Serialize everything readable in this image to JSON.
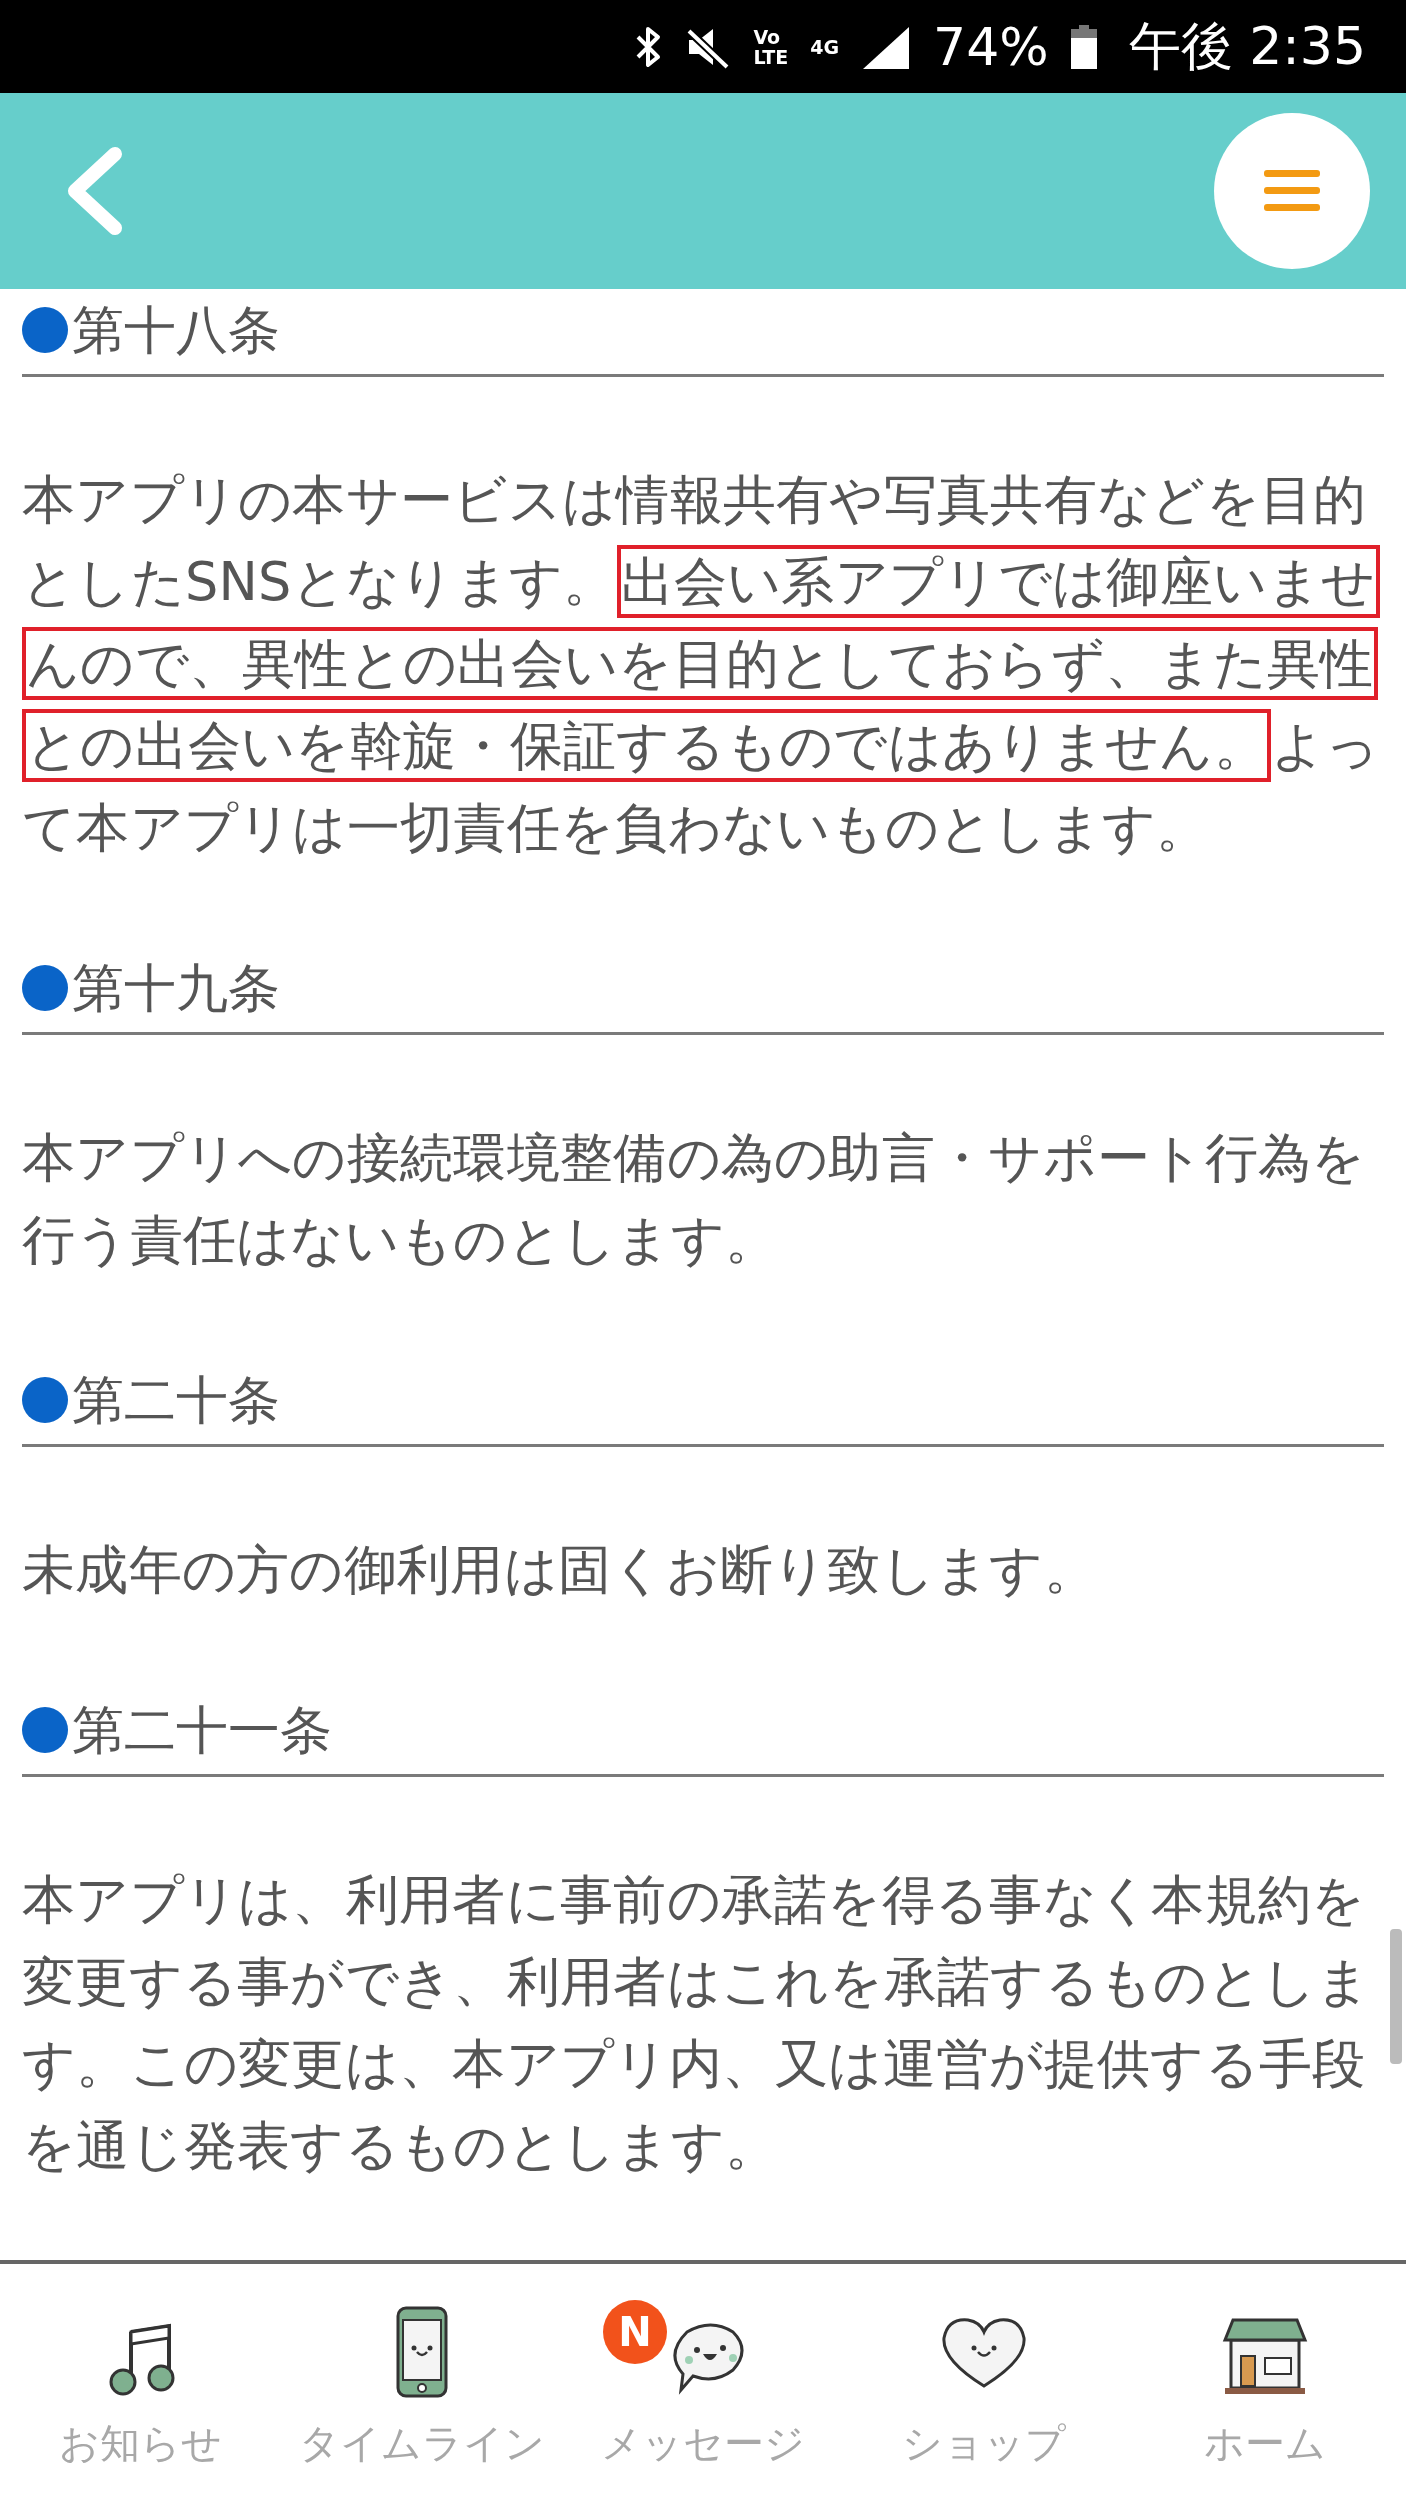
{
  "status_bar": {
    "network": [
      "Vo",
      "LTE",
      "4G"
    ],
    "battery": "74%",
    "time": "午後 2:35"
  },
  "sections": [
    {
      "title": "第十八条",
      "paragraph": [
        {
          "text": "本アプリの本サービスは情報共有や写真共有などを目的としたSNSとなります。",
          "highlighted": false
        },
        {
          "text": "出会い系アプリでは御座いませんので、異性との出会いを目的としておらず、また異性との出会いを斡旋・保証するものではありません。",
          "highlighted": true
        },
        {
          "text": "よって本アプリは一切責任を負わないものとします。",
          "highlighted": false
        }
      ]
    },
    {
      "title": "第十九条",
      "paragraph": [
        {
          "text": "本アプリへの接続環境整備の為の助言・サポート行為を行う責任はないものとします。",
          "highlighted": false
        }
      ]
    },
    {
      "title": "第二十条",
      "paragraph": [
        {
          "text": "未成年の方の御利用は固くお断り致します。",
          "highlighted": false
        }
      ]
    },
    {
      "title": "第二十一条",
      "paragraph": [
        {
          "text": "本アプリは、利用者に事前の承諾を得る事なく本規約を変更する事ができ、利用者はこれを承諾するものとします。この変更は、本アプリ内、又は運営が提供する手段を通じ発表するものとします。",
          "highlighted": false
        }
      ]
    }
  ],
  "bottom_nav": [
    {
      "kind": "notes",
      "label": "お知らせ"
    },
    {
      "kind": "phone",
      "label": "タイムライン"
    },
    {
      "kind": "chat",
      "label": "メッセージ",
      "badge": "N"
    },
    {
      "kind": "heart",
      "label": "ショップ"
    },
    {
      "kind": "shop",
      "label": "ホーム"
    }
  ]
}
